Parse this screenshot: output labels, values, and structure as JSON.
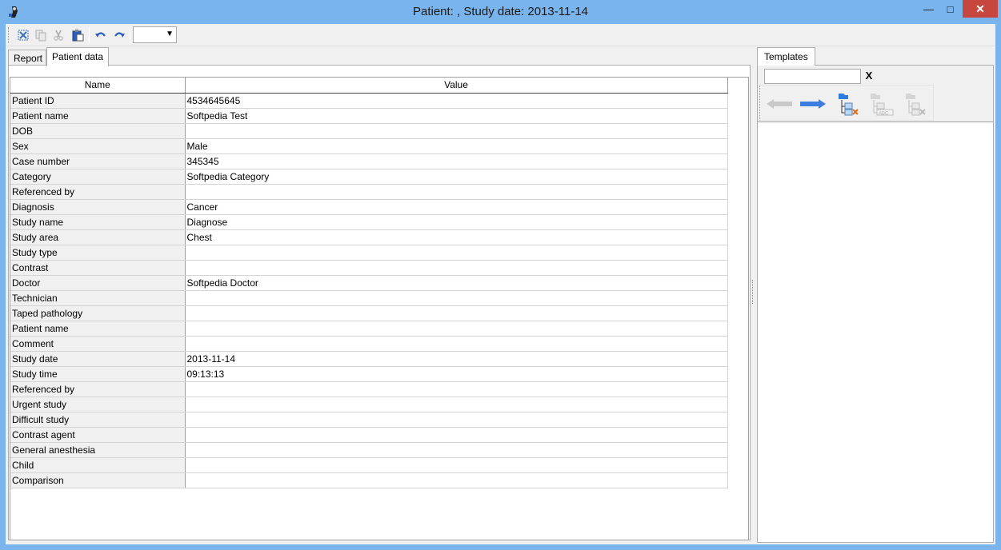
{
  "window": {
    "title": "Patient: , Study date: 2013-11-14",
    "minimize_glyph": "—",
    "maximize_glyph": "□",
    "close_glyph": "✕"
  },
  "toolbar": {
    "icons": [
      "select-all-icon",
      "copy-icon",
      "cut-icon",
      "paste-icon",
      "undo-icon",
      "redo-icon"
    ],
    "combo_value": "",
    "combo_arrow": "▼"
  },
  "tabs": [
    {
      "label": "Report",
      "active": false
    },
    {
      "label": "Patient data",
      "active": true
    }
  ],
  "grid": {
    "headers": {
      "name": "Name",
      "value": "Value"
    },
    "rows": [
      {
        "name": "Patient ID",
        "value": "4534645645"
      },
      {
        "name": "Patient name",
        "value": "Softpedia Test"
      },
      {
        "name": "DOB",
        "value": ""
      },
      {
        "name": "Sex",
        "value": "Male"
      },
      {
        "name": "Case number",
        "value": "345345"
      },
      {
        "name": "Category",
        "value": "Softpedia Category"
      },
      {
        "name": "Referenced by",
        "value": ""
      },
      {
        "name": "Diagnosis",
        "value": "Cancer"
      },
      {
        "name": "Study name",
        "value": "Diagnose"
      },
      {
        "name": "Study area",
        "value": "Chest"
      },
      {
        "name": "Study type",
        "value": ""
      },
      {
        "name": "Contrast",
        "value": ""
      },
      {
        "name": "Doctor",
        "value": "Softpedia Doctor"
      },
      {
        "name": "Technician",
        "value": ""
      },
      {
        "name": "Taped pathology",
        "value": ""
      },
      {
        "name": "Patient name",
        "value": ""
      },
      {
        "name": "Comment",
        "value": ""
      },
      {
        "name": "Study date",
        "value": "2013-11-14"
      },
      {
        "name": "Study time",
        "value": "09:13:13"
      },
      {
        "name": "Referenced by",
        "value": ""
      },
      {
        "name": "Urgent study",
        "value": ""
      },
      {
        "name": "Difficult study",
        "value": ""
      },
      {
        "name": "Contrast agent",
        "value": ""
      },
      {
        "name": "General anesthesia",
        "value": ""
      },
      {
        "name": "Child",
        "value": ""
      },
      {
        "name": "Comparison",
        "value": ""
      }
    ]
  },
  "templates": {
    "tab_label": "Templates",
    "search_value": "",
    "clear_label": "X",
    "buttons": [
      "back-arrow-icon",
      "forward-arrow-icon",
      "new-template-icon",
      "rename-template-icon",
      "delete-template-icon"
    ]
  },
  "colors": {
    "titlebar": "#7ab4ec",
    "close_button": "#c7463e",
    "arrow_blue": "#3d7de0",
    "arrow_disabled": "#c9c9c9"
  }
}
